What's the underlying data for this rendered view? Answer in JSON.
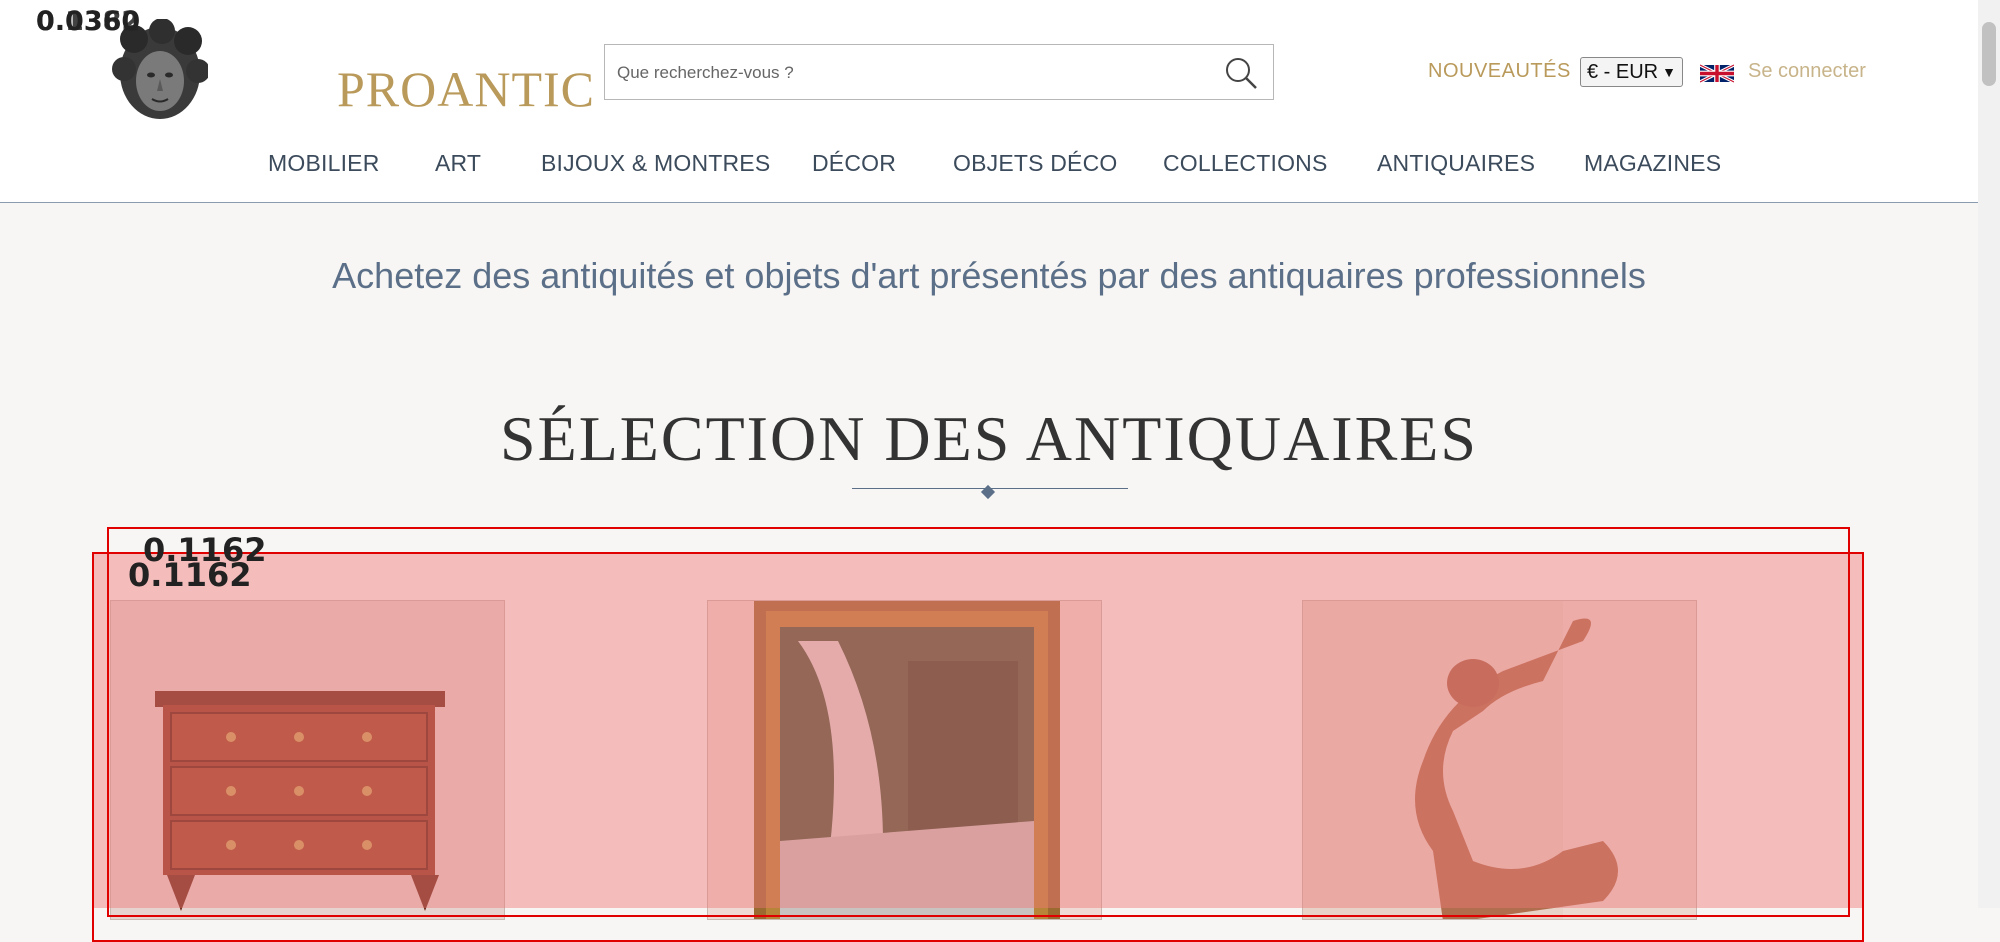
{
  "brand": {
    "name": "PROANTIC"
  },
  "search": {
    "placeholder": "Que recherchez-vous ?"
  },
  "header_links": {
    "new": "NOUVEAUTÉS",
    "currency": "€ - EUR",
    "login": "Se connecter"
  },
  "nav": [
    "MOBILIER",
    "ART",
    "BIJOUX & MONTRES",
    "DÉCOR",
    "OBJETS DÉCO",
    "COLLECTIONS",
    "ANTIQUAIRES",
    "MAGAZINES"
  ],
  "tagline": "Achetez des antiquités et objets d'art présentés par des antiquaires professionnels",
  "section": {
    "title": "SÉLECTION DES ANTIQUAIRES"
  },
  "products": [
    {
      "name": "commode"
    },
    {
      "name": "framed-waterfall-painting"
    },
    {
      "name": "terracotta-sculpture"
    }
  ],
  "overlay": {
    "corner_label_1": "0.0360",
    "corner_label_2": "0.1382",
    "box_label_1": "0.1162",
    "box_label_2": "0.1162"
  },
  "colors": {
    "gold": "#b99a5b",
    "navy": "#5b7088",
    "overlay_red": "#e00000"
  }
}
